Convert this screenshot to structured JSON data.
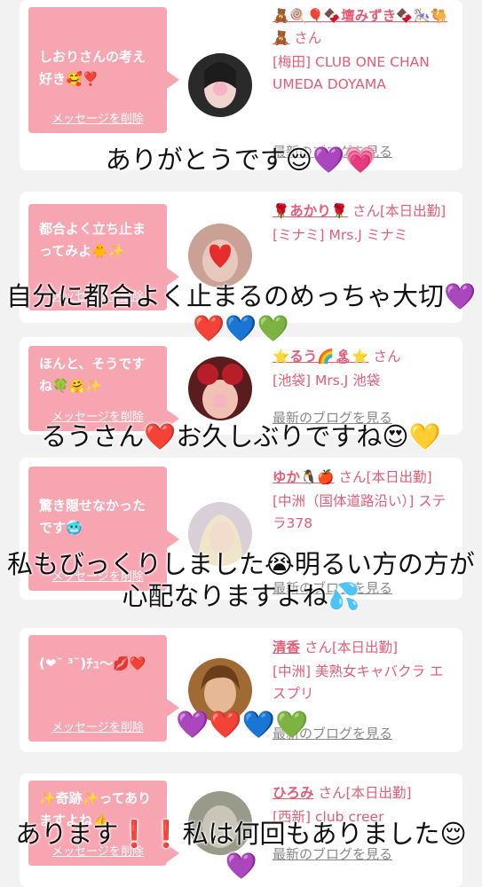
{
  "messages": [
    {
      "bubble_text": "しおりさんの考え好き🥰❣️",
      "delete_label": "メッセージを削除",
      "name": "🧸🍭🎈🍫壇みずき🍫🎠🐫🧸",
      "suffix": " さん",
      "shop": "[梅田] CLUB ONE CHAN UMEDA DOYAMA",
      "blog_label": "最新のブログを見る",
      "avatar_colors": [
        "#2a2a2a",
        "#f0d5cf"
      ]
    },
    {
      "bubble_text": "都合よく立ち止まってみよ🐥✨",
      "delete_label": "メッセージを削除",
      "name": "🌹あかり🌹",
      "suffix": " さん[本日出勤]",
      "shop": "[ミナミ] Mrs.J ミナミ",
      "blog_label": "最新のブログを見る",
      "avatar_colors": [
        "#c9a295",
        "#e8c8bd"
      ]
    },
    {
      "bubble_text": "ほんと、そうですね🍀🤗✨",
      "delete_label": "メッセージを削除",
      "name": "⭐るう🌈🏝⭐",
      "suffix": " さん",
      "shop": "[池袋] Mrs.J 池袋",
      "blog_label": "最新のブログを見る",
      "avatar_colors": [
        "#b81d2a",
        "#f1c2b4"
      ]
    },
    {
      "bubble_text": "驚き隠せなかったです🥶",
      "delete_label": "メッセージを削除",
      "name": "ゆか🐧🍎",
      "suffix": " さん[本日出勤]",
      "shop": "[中洲（国体道路沿い）] ステラ378",
      "blog_label": "最新のブログを見る",
      "avatar_colors": [
        "#d9cfd9",
        "#f2dccd"
      ]
    },
    {
      "bubble_text": "(❤︎˘ ³˘)ﾁｭ〜💋❤️",
      "delete_label": "メッセージを削除",
      "name": "清香",
      "suffix": " さん[本日出勤]",
      "shop": "[中洲] 美熟女キャバクラ エスプリ",
      "blog_label": "最新のブログを見る",
      "avatar_colors": [
        "#a06a35",
        "#e6b895"
      ]
    },
    {
      "bubble_text": "✨奇跡✨ってありますよね👍",
      "delete_label": "メッセージを削除",
      "name": "ひろみ",
      "suffix": " さん[本日出勤]",
      "shop": "[西新] club creer",
      "blog_label": "最新のブログを見る",
      "avatar_colors": [
        "#9a9a8a",
        "#c9c6b8"
      ]
    }
  ],
  "overlays": [
    "ありがとうです😌💜💗",
    "自分に都合よく止まるのめっちゃ大切💜❤️💙💚",
    "るうさん❤️お久しぶりですね😍💛",
    "私もびっくりしました😭明るい方の方が心配なりますよね💦",
    "💜❤️💙💚",
    "あります❗❗私は何回もありました😌💜"
  ],
  "colors": {
    "bubble": "#f8a5b2",
    "name": "#e45c76",
    "background": "#f2f2f2"
  }
}
